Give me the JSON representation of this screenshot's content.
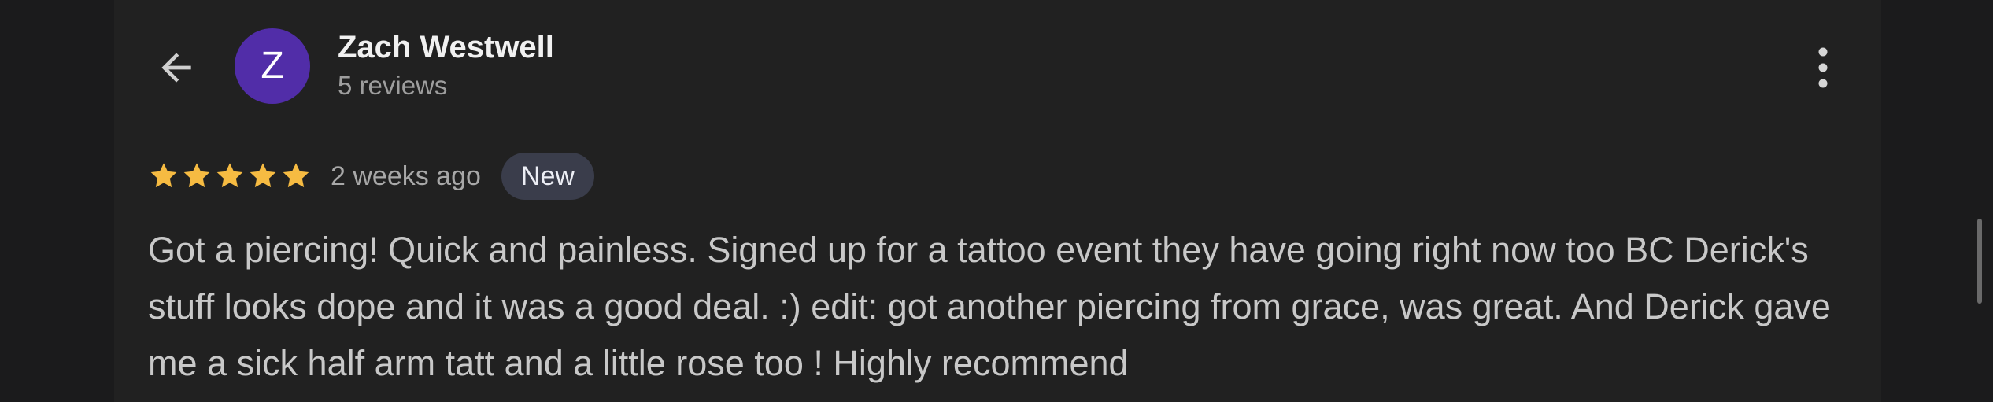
{
  "header": {
    "back_icon": "arrow-back-icon",
    "avatar_letter": "Z",
    "avatar_color": "#512da8",
    "reviewer_name": "Zach Westwell",
    "reviewer_meta": "5 reviews",
    "more_icon": "more-vert-icon"
  },
  "review": {
    "rating": 5,
    "max_rating": 5,
    "star_color": "#f6bb42",
    "time": "2 weeks ago",
    "badge": "New",
    "text": "Got a piercing! Quick and painless. Signed up for a tattoo event they have going right now too BC Derick's stuff looks dope and it was a good deal. :) edit: got another piercing from grace, was great. And Derick gave me a sick half arm tatt and a little rose too ! Highly recommend"
  }
}
